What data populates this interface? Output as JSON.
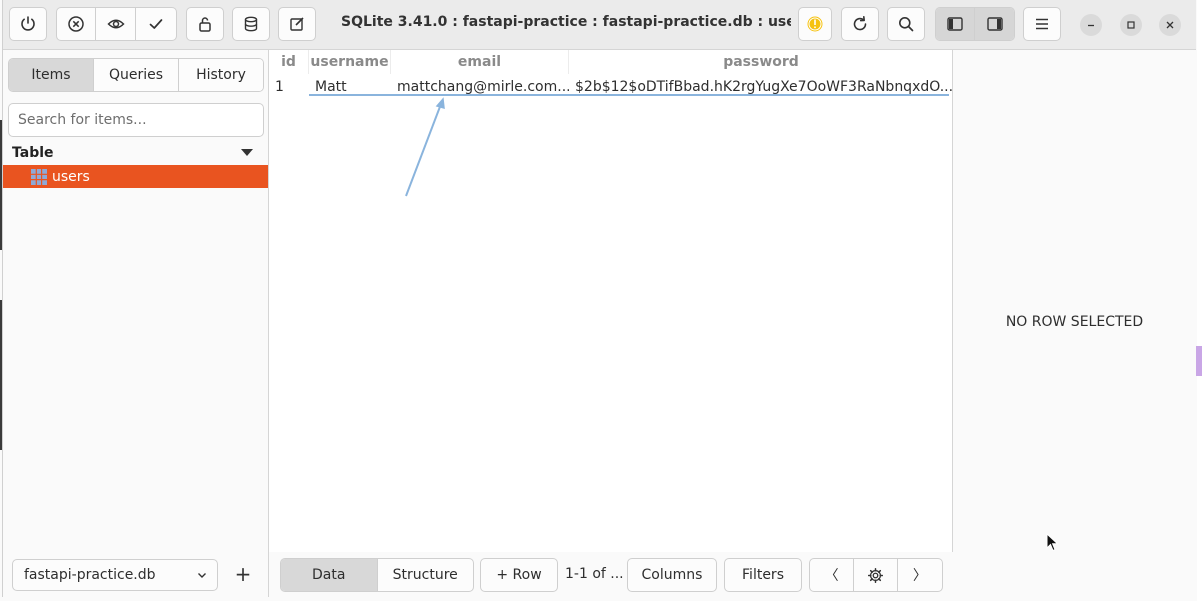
{
  "app": {
    "title": "SQLite 3.41.0 : fastapi-practice : fastapi-practice.db : use..."
  },
  "sidebar": {
    "tabs": [
      {
        "label": "Items",
        "active": true
      },
      {
        "label": "Queries",
        "active": false
      },
      {
        "label": "History",
        "active": false
      }
    ],
    "search_placeholder": "Search for items...",
    "section_label": "Table",
    "items": [
      {
        "label": "users",
        "selected": true
      }
    ],
    "database_select": "fastapi-practice.db",
    "add_label": "+"
  },
  "grid": {
    "columns": [
      "id",
      "username",
      "email",
      "password"
    ],
    "rows": [
      [
        "1",
        "Matt",
        "mattchang@mirle.com...",
        "$2b$12$oDTifBbad.hK2rgYugXe7OoWF3RaNbnqxdO..."
      ]
    ]
  },
  "bottom_bar": {
    "view_tabs": [
      {
        "label": "Data",
        "active": true
      },
      {
        "label": "Structure",
        "active": false
      }
    ],
    "add_row_label": "+ Row",
    "pagination": "1-1 of ...",
    "columns_label": "Columns",
    "filters_label": "Filters",
    "prev_label": "〈",
    "next_label": "〉"
  },
  "detail_panel": {
    "empty_message": "NO ROW SELECTED"
  },
  "colors": {
    "accent": "#e95420",
    "warning": "#f5c211",
    "selection_line": "#8ab4dd"
  }
}
